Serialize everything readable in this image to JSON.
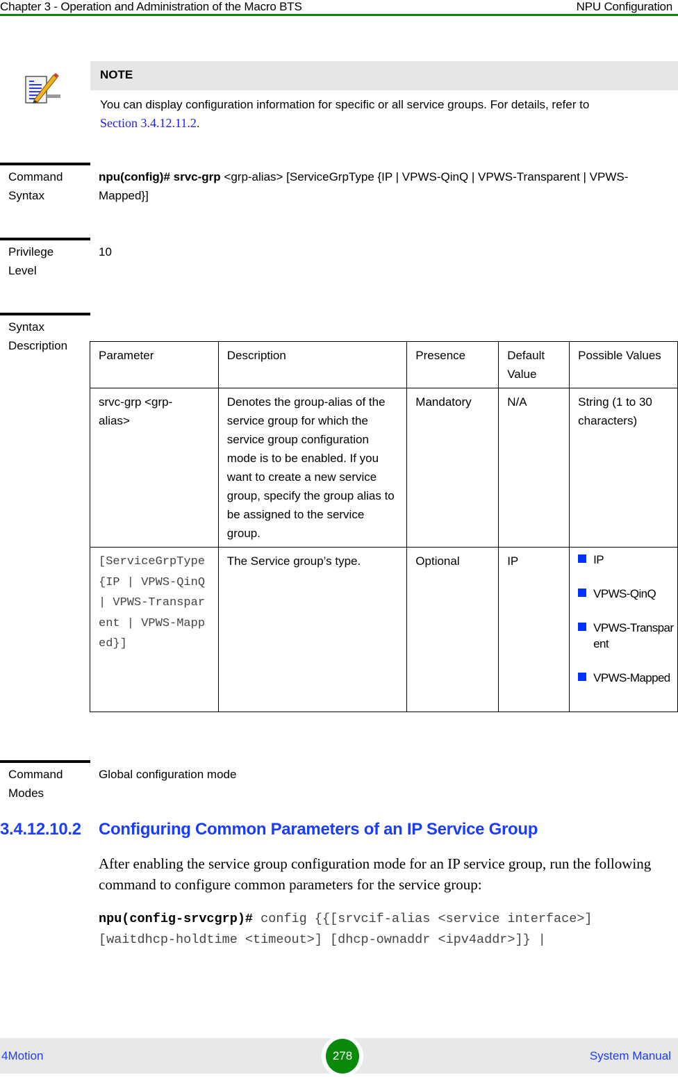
{
  "header": {
    "chapter": "Chapter 3 - Operation and Administration of the Macro BTS",
    "section": "NPU Configuration"
  },
  "note": {
    "icon": "note-pencil-icon",
    "title": "NOTE",
    "text": "You can display configuration information for specific or all service groups. For details, refer to",
    "link": "Section 3.4.12.11.2",
    "after_link": "."
  },
  "command_syntax": {
    "label_line1": "Command",
    "label_line2": "Syntax",
    "prompt_bold": "npu(config)# srvc-grp",
    "args": " <grp-alias> [ServiceGrpType {IP | VPWS-QinQ | VPWS-Transparent | VPWS-Mapped}]"
  },
  "privilege_level": {
    "label_line1": "Privilege",
    "label_line2": "Level",
    "value": "10"
  },
  "syntax_description": {
    "label_line1": "Syntax",
    "label_line2": "Description",
    "headers": [
      "Parameter",
      "Description",
      "Presence",
      "Default Value",
      "Possible Values"
    ],
    "rows": [
      {
        "parameter": "srvc-grp <grp-alias>",
        "description": "Denotes the group-alias of the service group for which the service group configuration mode is to be enabled. If you want to create a new service group, specify the group alias to be assigned to the service group.",
        "presence": "Mandatory",
        "default": "N/A",
        "possible": "String (1 to 30 characters)"
      },
      {
        "parameter": "[ServiceGrpType {IP | VPWS-QinQ | VPWS-Transparent | VPWS-Mapped}]",
        "description": "The Service group’s type.",
        "presence": "Optional",
        "default": "IP",
        "possible_list": [
          "IP",
          "VPWS-QinQ",
          "VPWS-Transparent",
          "VPWS-Mapped"
        ]
      }
    ]
  },
  "command_modes": {
    "label_line1": "Command",
    "label_line2": "Modes",
    "value": "Global configuration mode"
  },
  "section": {
    "number": "3.4.12.10.2",
    "title": "Configuring Common Parameters of an IP Service Group",
    "body": "After enabling the service group configuration mode for an IP service group, run the following command to configure common parameters for the service group:",
    "command_prompt": "npu(config-srvcgrp)#",
    "command_line1": " config {{[srvcif-alias <service interface>]",
    "command_line2": "[waitdhcp-holdtime <timeout>] [dhcp-ownaddr <ipv4addr>]} |"
  },
  "footer": {
    "product": "4Motion",
    "page": "278",
    "manual": "System Manual"
  },
  "colors": {
    "header_rule": "#108010",
    "link": "#1a1aff",
    "heading": "#1a3cff",
    "bullet": "#0033ff",
    "page_badge": "#0a8a0a"
  }
}
